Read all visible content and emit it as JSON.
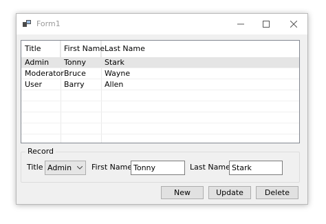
{
  "window": {
    "title": "Form1",
    "minimize_glyph": "minimize-icon",
    "maximize_glyph": "maximize-icon",
    "close_glyph": "close-icon"
  },
  "grid": {
    "columns": [
      "Title",
      "First Name",
      "Last Name"
    ],
    "rows": [
      {
        "title": "Admin",
        "first": "Tonny",
        "last": "Stark"
      },
      {
        "title": "Moderator",
        "first": "Bruce",
        "last": "Wayne"
      },
      {
        "title": "User",
        "first": "Barry",
        "last": "Allen"
      }
    ],
    "selected_row": 0
  },
  "record": {
    "legend": "Record",
    "title_label": "Title",
    "title_value": "Admin",
    "first_label": "First Name",
    "first_value": "Tonny",
    "last_label": "Last Name",
    "last_value": "Stark"
  },
  "buttons": {
    "new": "New",
    "update": "Update",
    "delete": "Delete"
  },
  "colors": {
    "selection": "#e5e5e5",
    "form_background": "#f0f0f0",
    "button_background": "#e1e1e1"
  }
}
